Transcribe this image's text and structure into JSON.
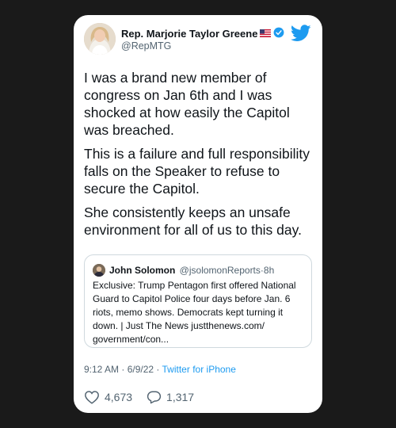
{
  "author": {
    "name": "Rep. Marjorie Taylor Greene",
    "handle": "@RepMTG"
  },
  "tweet": {
    "paragraphs": [
      "I was a brand new member of congress on Jan 6th and I was shocked at how easily the Capitol was breached.",
      "This is a failure and full responsibility falls on the Speaker to refuse to secure the Capitol.",
      "She consistently keeps an unsafe environment for all of us to this day."
    ]
  },
  "quoted_tweet": {
    "name": "John Solomon",
    "handle": "@jsolomonReports",
    "age": "8h",
    "text": "Exclusive: Trump Pentagon first offered National Guard to Capitol Police four days before Jan. 6 riots, memo shows. Democrats kept turning it down. | Just The News justthenews.com/ government/con..."
  },
  "meta": {
    "timestamp": "9:12 AM · 6/9/22 · ",
    "source": "Twitter for iPhone"
  },
  "stats": {
    "likes": "4,673",
    "replies": "1,317"
  },
  "colors": {
    "accent": "#1d9bf0",
    "text": "#0f1419",
    "secondary": "#536471",
    "background": "#1a1a1a"
  },
  "icons": [
    "verified-badge-icon",
    "us-flag-icon",
    "twitter-bird-icon",
    "heart-icon",
    "reply-icon"
  ]
}
